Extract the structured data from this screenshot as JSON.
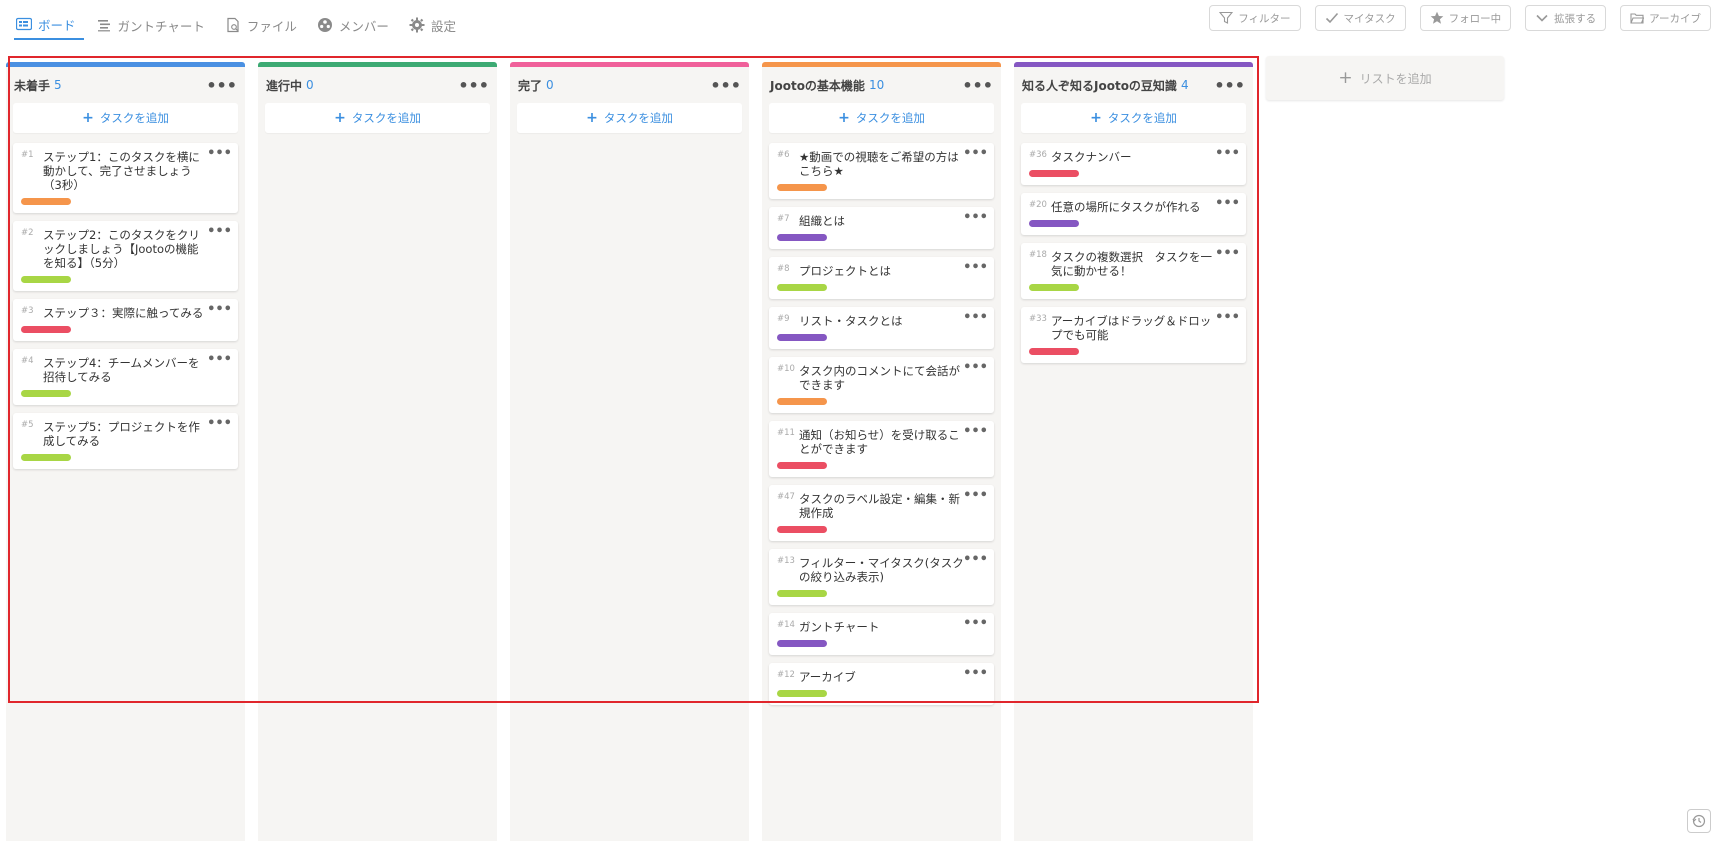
{
  "nav": {
    "tabs": [
      {
        "label": "ボード",
        "icon": "board-icon",
        "active": true
      },
      {
        "label": "ガントチャート",
        "icon": "gantt-icon",
        "active": false
      },
      {
        "label": "ファイル",
        "icon": "file-icon",
        "active": false
      },
      {
        "label": "メンバー",
        "icon": "member-icon",
        "active": false
      },
      {
        "label": "設定",
        "icon": "gear-icon",
        "active": false
      }
    ],
    "actions": [
      {
        "label": "フィルター",
        "icon": "filter-icon"
      },
      {
        "label": "マイタスク",
        "icon": "check-icon"
      },
      {
        "label": "フォロー中",
        "icon": "star-icon"
      },
      {
        "label": "拡張する",
        "icon": "chevron-down-icon"
      },
      {
        "label": "アーカイブ",
        "icon": "folder-icon"
      }
    ]
  },
  "colors": {
    "orange": "#f5954b",
    "green": "#a8d645",
    "red": "#eb4e63",
    "purple": "#8557c2",
    "accent": "#3b8fe0",
    "highlight": "#e0262c"
  },
  "add_task_label": "タスクを追加",
  "add_list_label": "リストを追加",
  "lists": [
    {
      "name": "未着手",
      "count": "5",
      "color": "#4a90e2",
      "cards": [
        {
          "num": "#1",
          "title": "ステップ1：このタスクを横に動かして、完了させましょう（3秒）",
          "label": "#f5954b"
        },
        {
          "num": "#2",
          "title": "ステップ2：このタスクをクリックしましょう【Jootoの機能を知る】（5分）",
          "label": "#a8d645"
        },
        {
          "num": "#3",
          "title": "ステップ３：実際に触ってみる",
          "label": "#eb4e63"
        },
        {
          "num": "#4",
          "title": "ステップ4：チームメンバーを招待してみる",
          "label": "#a8d645"
        },
        {
          "num": "#5",
          "title": "ステップ5：プロジェクトを作成してみる",
          "label": "#a8d645"
        }
      ]
    },
    {
      "name": "進行中",
      "count": "0",
      "color": "#3daa73",
      "cards": []
    },
    {
      "name": "完了",
      "count": "0",
      "color": "#f0609a",
      "cards": []
    },
    {
      "name": "Jootoの基本機能",
      "count": "10",
      "color": "#f5954b",
      "cards": [
        {
          "num": "#6",
          "title": "★動画での視聴をご希望の方はこちら★",
          "label": "#f5954b"
        },
        {
          "num": "#7",
          "title": "組織とは",
          "label": "#8557c2"
        },
        {
          "num": "#8",
          "title": "プロジェクトとは",
          "label": "#a8d645"
        },
        {
          "num": "#9",
          "title": "リスト・タスクとは",
          "label": "#8557c2"
        },
        {
          "num": "#10",
          "title": "タスク内のコメントにて会話ができます",
          "label": "#f5954b"
        },
        {
          "num": "#11",
          "title": "通知（お知らせ）を受け取ることができます",
          "label": "#eb4e63"
        },
        {
          "num": "#47",
          "title": "タスクのラベル設定・編集・新規作成",
          "label": "#eb4e63"
        },
        {
          "num": "#13",
          "title": "フィルター・マイタスク(タスクの絞り込み表示)",
          "label": "#a8d645"
        },
        {
          "num": "#14",
          "title": "ガントチャート",
          "label": "#8557c2"
        },
        {
          "num": "#12",
          "title": "アーカイブ",
          "label": "#a8d645"
        }
      ]
    },
    {
      "name": "知る人ぞ知るJootoの豆知識",
      "count": "4",
      "color": "#8557c2",
      "cards": [
        {
          "num": "#36",
          "title": "タスクナンバー",
          "label": "#eb4e63"
        },
        {
          "num": "#20",
          "title": "任意の場所にタスクが作れる",
          "label": "#8557c2"
        },
        {
          "num": "#18",
          "title": "タスクの複数選択　タスクを一気に動かせる！",
          "label": "#a8d645"
        },
        {
          "num": "#33",
          "title": "アーカイブはドラッグ＆ドロップでも可能",
          "label": "#eb4e63"
        }
      ]
    }
  ]
}
